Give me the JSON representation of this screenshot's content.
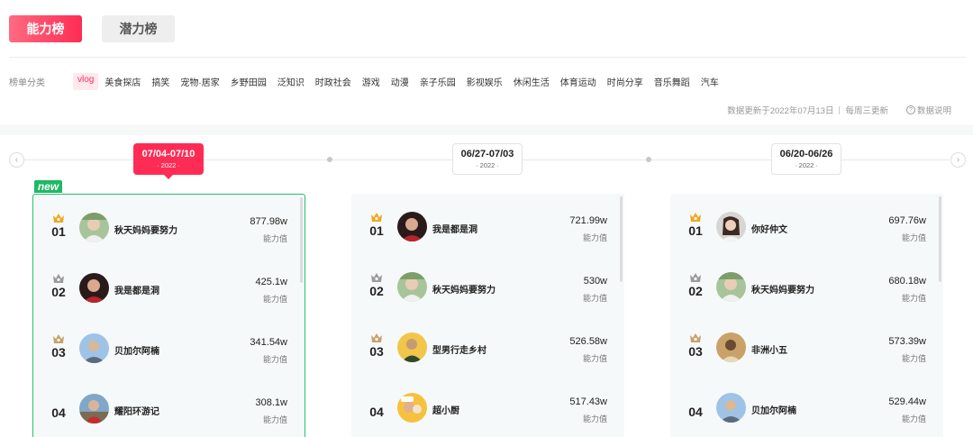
{
  "tabs": [
    {
      "label": "能力榜"
    },
    {
      "label": "潜力榜"
    }
  ],
  "category_label": "榜单分类",
  "categories": [
    "vlog",
    "美食探店",
    "搞笑",
    "宠物·居家",
    "乡野田园",
    "泛知识",
    "时政社会",
    "游戏",
    "动漫",
    "亲子乐园",
    "影视娱乐",
    "休闲生活",
    "体育运动",
    "时尚分享",
    "音乐舞蹈",
    "汽车"
  ],
  "update": {
    "updated_text": "数据更新于2022年07月13日",
    "frequency_text": "每周三更新",
    "help_text": "数据说明"
  },
  "new_badge": "new",
  "score_label": "能力值",
  "weeks": [
    {
      "range": "07/04-07/10",
      "year": "· 2022 ·",
      "entries": [
        {
          "rank": "01",
          "name": "秋天妈妈要努力",
          "score": "877.98w"
        },
        {
          "rank": "02",
          "name": "我是都是洞",
          "score": "425.1w"
        },
        {
          "rank": "03",
          "name": "贝加尔阿楠",
          "score": "341.54w"
        },
        {
          "rank": "04",
          "name": "耀阳环游记",
          "score": "308.1w"
        }
      ]
    },
    {
      "range": "06/27-07/03",
      "year": "· 2022 ·",
      "entries": [
        {
          "rank": "01",
          "name": "我是都是洞",
          "score": "721.99w"
        },
        {
          "rank": "02",
          "name": "秋天妈妈要努力",
          "score": "530w"
        },
        {
          "rank": "03",
          "name": "型男行走乡村",
          "score": "526.58w"
        },
        {
          "rank": "04",
          "name": "超小厨",
          "score": "517.43w"
        }
      ]
    },
    {
      "range": "06/20-06/26",
      "year": "· 2022 ·",
      "entries": [
        {
          "rank": "01",
          "name": "你好仲文",
          "score": "697.76w"
        },
        {
          "rank": "02",
          "name": "秋天妈妈要努力",
          "score": "680.18w"
        },
        {
          "rank": "03",
          "name": "非洲小五",
          "score": "573.39w"
        },
        {
          "rank": "04",
          "name": "贝加尔阿楠",
          "score": "529.44w"
        }
      ]
    }
  ],
  "colors": {
    "accent": "#fe2c55",
    "new_green": "#1fb964",
    "gold": "#f2a622",
    "silver": "#9a9a9a",
    "bronze": "#c9a16a"
  }
}
